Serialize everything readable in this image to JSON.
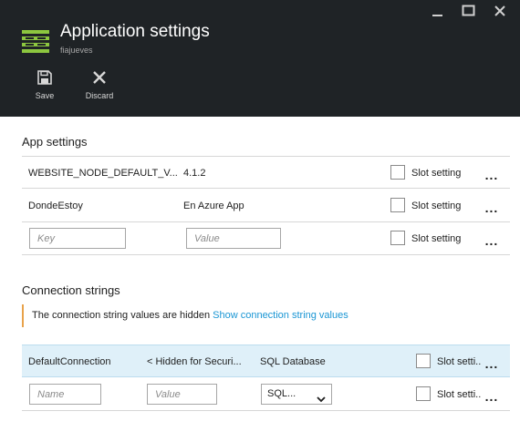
{
  "header": {
    "title": "Application settings",
    "subtitle": "fiajueves",
    "window_controls": [
      "minimize-icon",
      "maximize-icon",
      "close-icon"
    ],
    "commands": [
      {
        "label": "Save",
        "icon": "save-icon"
      },
      {
        "label": "Discard",
        "icon": "discard-icon"
      }
    ],
    "app_icon": "app-settings-icon",
    "app_icon_color": "#8cc63f"
  },
  "app_settings": {
    "heading": "App settings",
    "rows": [
      {
        "key": "WEBSITE_NODE_DEFAULT_V...",
        "value": "4.1.2",
        "slot_label": "Slot setting",
        "slot_checked": false
      },
      {
        "key": "DondeEstoy",
        "value": "En Azure App",
        "slot_label": "Slot setting",
        "slot_checked": false
      }
    ],
    "new_row": {
      "key_placeholder": "Key",
      "value_placeholder": "Value",
      "slot_label": "Slot setting"
    }
  },
  "connection_strings": {
    "heading": "Connection strings",
    "info_text": "The connection string values are hidden",
    "info_link": "Show connection string values",
    "rows": [
      {
        "name": "DefaultConnection",
        "value": "< Hidden for Securi...",
        "type": "SQL Database",
        "slot_label": "Slot setti...",
        "slot_checked": false
      }
    ],
    "new_row": {
      "name_placeholder": "Name",
      "value_placeholder": "Value",
      "type_selected": "SQL...",
      "slot_label": "Slot setti..."
    }
  },
  "colors": {
    "header_bg": "#1f2326",
    "accent_link": "#1a96d4",
    "warning_border": "#e8a24a",
    "row_highlight": "#dff0f9"
  }
}
